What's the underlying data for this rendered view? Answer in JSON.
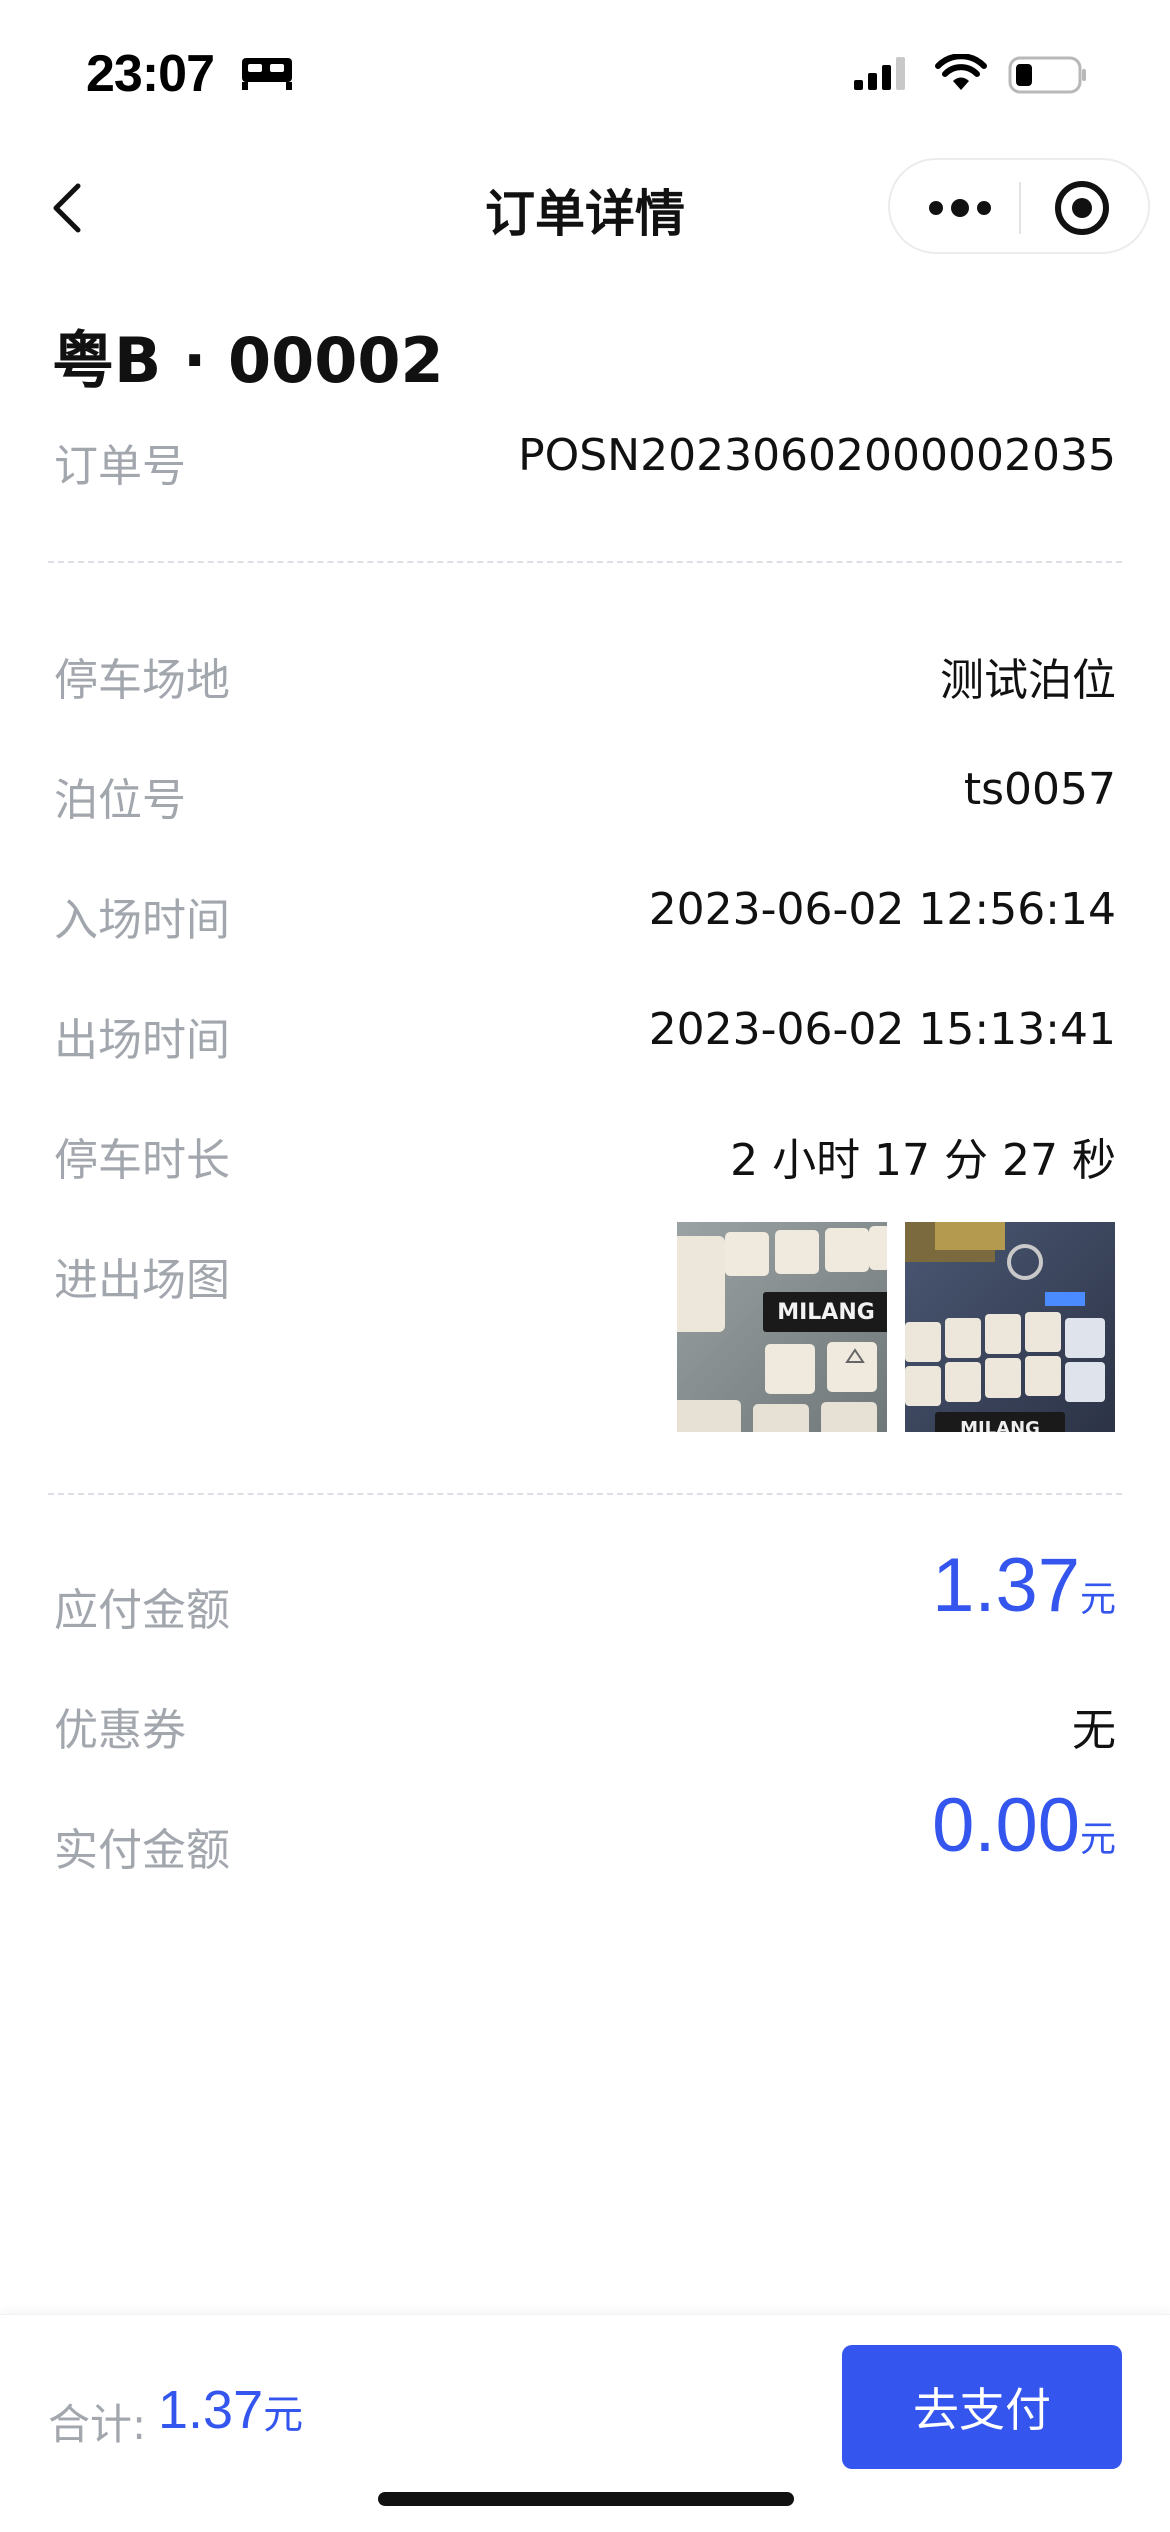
{
  "status_bar": {
    "time": "23:07"
  },
  "nav": {
    "title": "订单详情"
  },
  "order": {
    "plate": "粤B · 00002",
    "order_no_label": "订单号",
    "order_no": "POSN20230602000002035"
  },
  "details": [
    {
      "label": "停车场地",
      "value": "测试泊位"
    },
    {
      "label": "泊位号",
      "value": "ts0057"
    },
    {
      "label": "入场时间",
      "value": "2023-06-02 12:56:14"
    },
    {
      "label": "出场时间",
      "value": "2023-06-02 15:13:41"
    },
    {
      "label": "停车时长",
      "value": "2 小时 17 分 27 秒"
    }
  ],
  "photos": {
    "label": "进出场图",
    "captions": [
      "MILANG",
      "MILANG"
    ]
  },
  "amounts": {
    "payable_label": "应付金额",
    "payable": "1.37",
    "coupon_label": "优惠券",
    "coupon": "无",
    "paid_label": "实付金额",
    "paid": "0.00",
    "unit": "元"
  },
  "footer": {
    "total_label": "合计:",
    "total": "1.37",
    "unit": "元",
    "pay_label": "去支付"
  },
  "colors": {
    "accent": "#3556ee",
    "label": "#a2a6ad",
    "text": "#111111"
  }
}
